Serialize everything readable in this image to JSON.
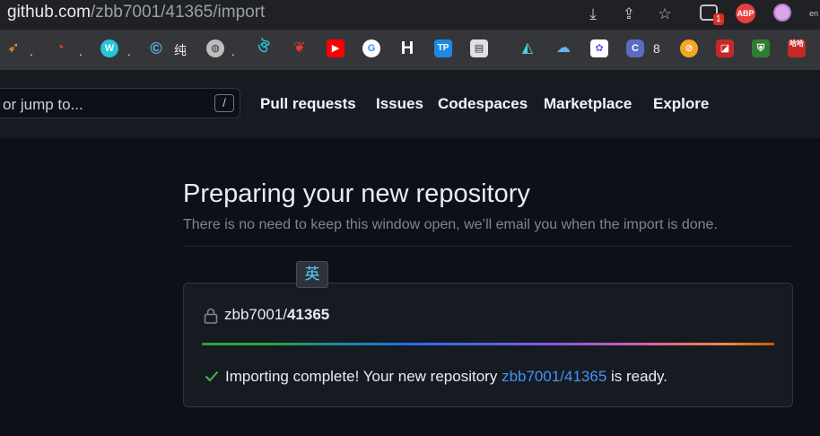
{
  "browser": {
    "url_host": "github.com",
    "url_path": "/zbb7001/41365/import",
    "ext_badge_count": "1",
    "abp_label": "ABP",
    "lang_label": "en"
  },
  "bookmarks": {
    "dot": ".",
    "chun_label": "纯",
    "h_label": "H",
    "tp_label": "TP",
    "eight_label": "8",
    "cn_label": "哈哈"
  },
  "header": {
    "search_placeholder": "or jump to...",
    "slash_hint": "/",
    "nav": [
      "Pull requests",
      "Issues",
      "Codespaces",
      "Marketplace",
      "Explore"
    ]
  },
  "main": {
    "title": "Preparing your new repository",
    "subtitle": "There is no need to keep this window open, we’ll email you when the import is done.",
    "ime_label": "英",
    "repo_owner": "zbb7001/",
    "repo_name": "41365",
    "progress_percent": 100,
    "status_prefix": "Importing complete! Your new repository ",
    "status_link": "zbb7001/41365",
    "status_suffix": " is ready."
  },
  "colors": {
    "bg": "#0d1117",
    "header_bg": "#161b22",
    "link": "#4493f8",
    "success": "#3fb950"
  }
}
